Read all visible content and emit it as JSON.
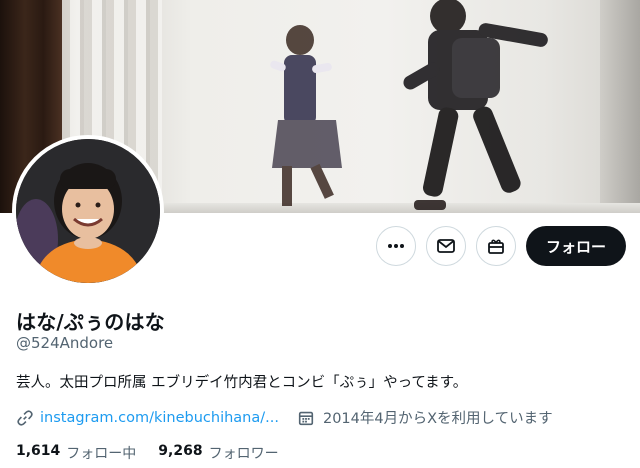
{
  "profile": {
    "name": "はな/ぷぅのはな",
    "handle": "@524Andore",
    "bio": "芸人。太田プロ所属 エブリデイ竹内君とコンビ「ぷぅ」やってます。",
    "link": "instagram.com/kinebuchihana/...",
    "joined": "2014年4月からXを利用しています"
  },
  "counts": {
    "following_value": "1,614",
    "following_label": "フォロー中",
    "followers_value": "9,268",
    "followers_label": "フォロワー"
  },
  "actions": {
    "follow_label": "フォロー",
    "more_icon": "more-icon",
    "message_icon": "envelope-icon",
    "subscribe_icon": "gift-icon"
  },
  "colors": {
    "accent": "#1d9bf0",
    "primary_text": "#0f1419",
    "secondary_text": "#536471",
    "follow_bg": "#0f1419"
  }
}
